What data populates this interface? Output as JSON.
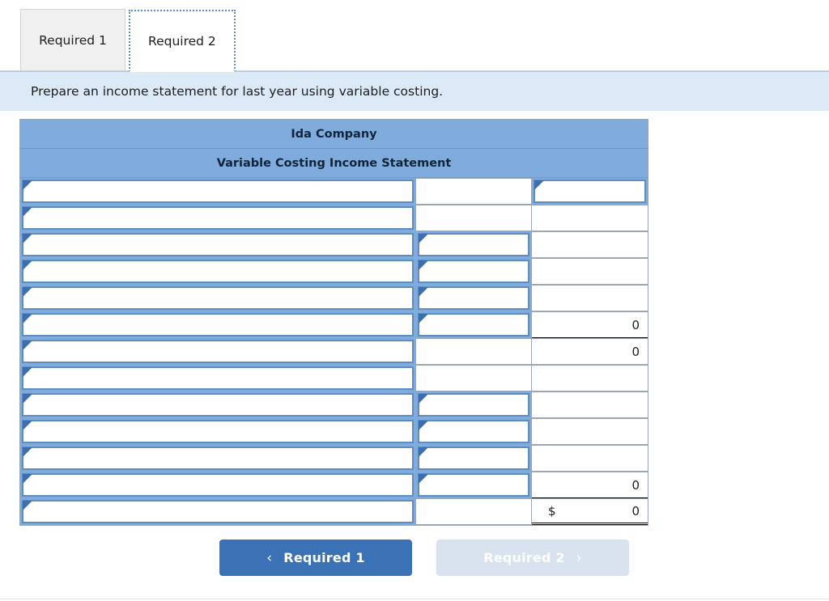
{
  "tabs": [
    {
      "label": "Required 1",
      "active": false
    },
    {
      "label": "Required 2",
      "active": true
    }
  ],
  "banner": {
    "instruction": "Prepare an income statement for last year using variable costing."
  },
  "sheet": {
    "company_title": "Ida Company",
    "statement_title": "Variable Costing Income Statement",
    "rows": [
      {
        "a": "",
        "b": "",
        "c": ""
      },
      {
        "a": "",
        "b": "",
        "c": ""
      },
      {
        "a": "",
        "b": "",
        "c": ""
      },
      {
        "a": "",
        "b": "",
        "c": ""
      },
      {
        "a": "",
        "b": "",
        "c": ""
      },
      {
        "a": "",
        "b": "",
        "c": "0"
      },
      {
        "a": "",
        "b": "",
        "c": "0"
      },
      {
        "a": "",
        "b": "",
        "c": ""
      },
      {
        "a": "",
        "b": "",
        "c": ""
      },
      {
        "a": "",
        "b": "",
        "c": ""
      },
      {
        "a": "",
        "b": "",
        "c": ""
      },
      {
        "a": "",
        "b": "",
        "c": "0"
      },
      {
        "a": "",
        "b": "",
        "c": "0",
        "c_currency": "$"
      }
    ]
  },
  "nav": {
    "prev_label": "Required 1",
    "prev_chevron": "‹",
    "next_label": "Required 2",
    "next_chevron": "›"
  },
  "colors": {
    "header_blue": "#7fabdd",
    "banner_blue": "#dceaf8",
    "input_border": "#5f8dc2",
    "button_primary": "#3a72b5",
    "button_disabled": "#d9e3f0"
  }
}
